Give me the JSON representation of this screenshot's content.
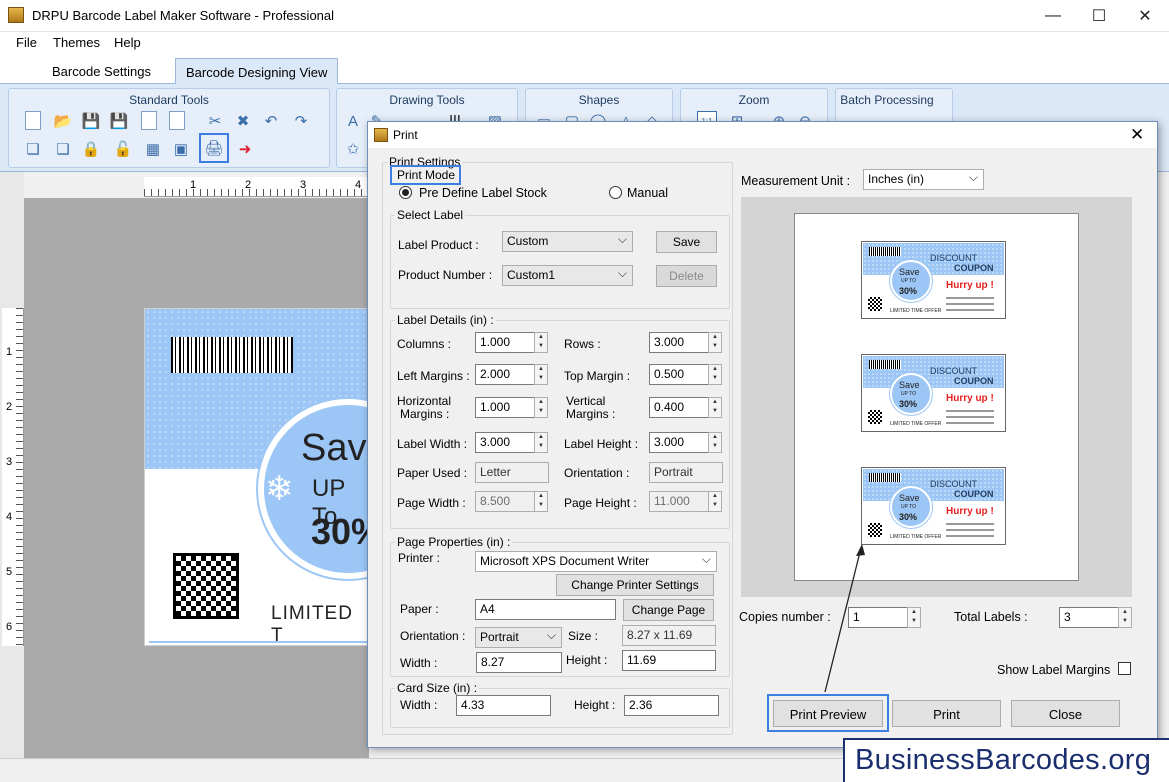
{
  "window": {
    "title": "DRPU Barcode Label Maker Software - Professional",
    "min": "—",
    "max": "☐",
    "close": "✕"
  },
  "menu": [
    "File",
    "Themes",
    "Help"
  ],
  "tabs": [
    "Barcode Settings",
    "Barcode Designing View"
  ],
  "ribbon": {
    "groups": [
      "Standard Tools",
      "Drawing Tools",
      "Shapes",
      "Zoom",
      "Batch Processing"
    ],
    "zoom_label": "1:1"
  },
  "ruler": {
    "h": [
      "1",
      "2",
      "3",
      "4"
    ],
    "v": [
      "1",
      "2",
      "3",
      "4",
      "5",
      "6"
    ]
  },
  "label": {
    "save": "Sav",
    "upto": "UP To",
    "pct": "30%",
    "limited": "LIMITED T"
  },
  "dialog": {
    "title": "Print",
    "close": "✕",
    "print_settings": "Print Settings",
    "print_mode": {
      "legend": "Print Mode",
      "option1": "Pre Define Label Stock",
      "option2": "Manual",
      "selected": "Pre Define Label Stock"
    },
    "select_label": {
      "legend": "Select Label",
      "product_label": "Label Product :",
      "product_value": "Custom",
      "number_label": "Product Number :",
      "number_value": "Custom1",
      "save": "Save",
      "delete": "Delete"
    },
    "details": {
      "legend": "Label Details (in) :",
      "columns_label": "Columns :",
      "columns": "1.000",
      "rows_label": "Rows :",
      "rows": "3.000",
      "left_label": "Left Margins :",
      "left": "2.000",
      "top_label": "Top Margin :",
      "top": "0.500",
      "hmargin_label1": "Horizontal",
      "hmargin_label2": "Margins :",
      "hmargin": "1.000",
      "vmargin_label1": "Vertical",
      "vmargin_label2": "Margins :",
      "vmargin": "0.400",
      "width_label": "Label Width :",
      "width": "3.000",
      "height_label": "Label Height :",
      "height": "3.000",
      "paper_label": "Paper Used :",
      "paper": "Letter",
      "orient_label": "Orientation :",
      "orient": "Portrait",
      "pwidth_label": "Page Width :",
      "pwidth": "8.500",
      "pheight_label": "Page Height :",
      "pheight": "11.000"
    },
    "page": {
      "legend": "Page Properties (in) :",
      "printer_label": "Printer :",
      "printer": "Microsoft XPS Document Writer",
      "change_printer": "Change Printer Settings",
      "paper_label": "Paper :",
      "paper": "A4",
      "change_page": "Change Page",
      "orient_label": "Orientation :",
      "orient": "Portrait",
      "size_label": "Size :",
      "size": "8.27 x 11.69",
      "width_label": "Width :",
      "width": "8.27",
      "height_label": "Height :",
      "height": "11.69"
    },
    "card": {
      "legend": "Card Size (in) :",
      "width_label": "Width :",
      "width": "4.33",
      "height_label": "Height :",
      "height": "2.36"
    },
    "measure_label": "Measurement Unit :",
    "measure_value": "Inches (in)",
    "mini_label": {
      "save": "Save",
      "upto": "UP TO",
      "pct": "30%",
      "discount": "DISCOUNT",
      "coupon": "COUPON",
      "hurry": "Hurry up !",
      "limited": "LIMITED TIME OFFER"
    },
    "copies_label": "Copies number :",
    "copies": "1",
    "total_label": "Total Labels :",
    "total": "3",
    "show_margins": "Show Label Margins",
    "btn_preview": "Print Preview",
    "btn_print": "Print",
    "btn_close": "Close"
  },
  "watermark": "BusinessBarcodes.org"
}
